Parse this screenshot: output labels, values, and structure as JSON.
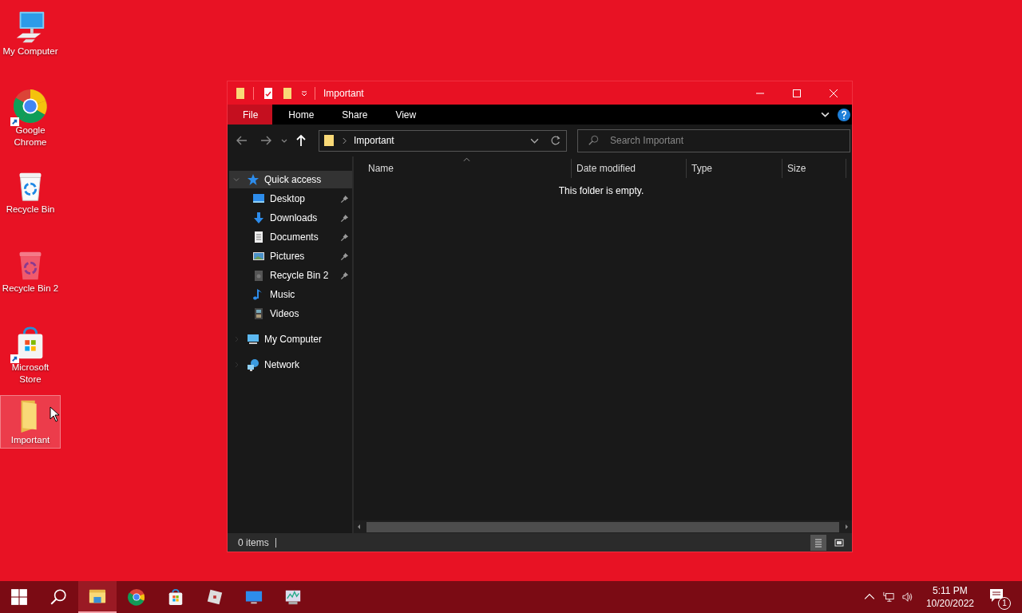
{
  "desktop_icons": [
    {
      "label": "My Computer",
      "kind": "computer",
      "shortcut": false,
      "selected": false
    },
    {
      "label": "Google Chrome",
      "kind": "chrome",
      "shortcut": true,
      "selected": false
    },
    {
      "label": "Recycle Bin",
      "kind": "recycle",
      "shortcut": false,
      "selected": false
    },
    {
      "label": "Recycle Bin 2",
      "kind": "recycle-red",
      "shortcut": false,
      "selected": false
    },
    {
      "label": "Microsoft Store",
      "kind": "store",
      "shortcut": true,
      "selected": false
    },
    {
      "label": "Important",
      "kind": "folder",
      "shortcut": false,
      "selected": true
    }
  ],
  "window": {
    "title": "Important",
    "ribbon_tabs": [
      {
        "label": "File",
        "selected": true
      },
      {
        "label": "Home",
        "selected": false
      },
      {
        "label": "Share",
        "selected": false
      },
      {
        "label": "View",
        "selected": false
      }
    ],
    "address": "Important",
    "search": {
      "placeholder": "Search Important"
    },
    "nav_pane": [
      {
        "label": "Quick access",
        "kind": "star",
        "expanded": true,
        "selected": true,
        "children": [
          {
            "label": "Desktop",
            "kind": "desktop",
            "pinned": true
          },
          {
            "label": "Downloads",
            "kind": "download",
            "pinned": true
          },
          {
            "label": "Documents",
            "kind": "document",
            "pinned": true
          },
          {
            "label": "Pictures",
            "kind": "picture",
            "pinned": true
          },
          {
            "label": "Recycle Bin 2",
            "kind": "recycle",
            "pinned": true
          },
          {
            "label": "Music",
            "kind": "music",
            "pinned": false
          },
          {
            "label": "Videos",
            "kind": "video",
            "pinned": false
          }
        ]
      },
      {
        "label": "My Computer",
        "kind": "computer",
        "expanded": false,
        "selected": false
      },
      {
        "label": "Network",
        "kind": "network",
        "expanded": false,
        "selected": false
      }
    ],
    "columns": [
      "Name",
      "Date modified",
      "Type",
      "Size"
    ],
    "empty_message": "This folder is empty.",
    "status": "0 items"
  },
  "taskbar": {
    "apps": [
      {
        "kind": "explorer",
        "active": true
      },
      {
        "kind": "chrome",
        "active": false
      },
      {
        "kind": "store",
        "active": false
      },
      {
        "kind": "roblox",
        "active": false
      },
      {
        "kind": "monitor",
        "active": false
      },
      {
        "kind": "perfmon",
        "active": false
      }
    ],
    "time": "5:11 PM",
    "date": "10/20/2022",
    "notification_count": "1"
  }
}
